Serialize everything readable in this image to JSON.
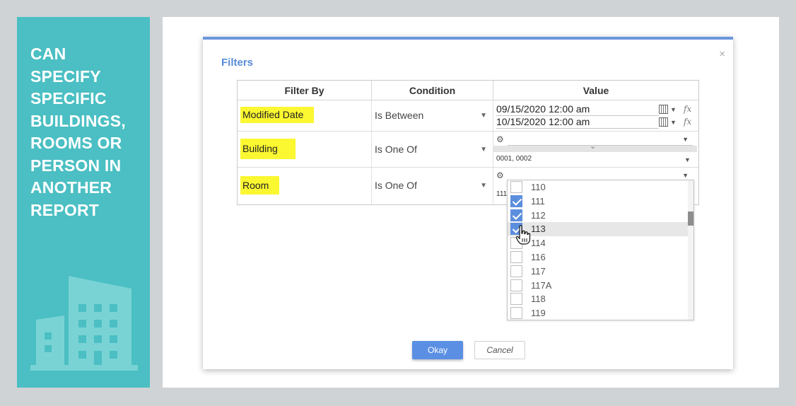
{
  "sidebar": {
    "lines": [
      "CAN",
      "SPECIFY",
      "SPECIFIC",
      "BUILDINGS,",
      "ROOMS OR",
      "PERSON IN",
      "ANOTHER",
      "REPORT"
    ],
    "illustration": "building-icon",
    "bg_color": "#4bbfc3"
  },
  "dialog": {
    "title": "Filters",
    "close_icon": "×",
    "columns": [
      "Filter By",
      "Condition",
      "Value"
    ],
    "rows": [
      {
        "filter_by": "Modified Date",
        "condition": "Is Between",
        "values": [
          "09/15/2020 12:00 am",
          "10/15/2020 12:00 am"
        ]
      },
      {
        "filter_by": "Building",
        "condition": "Is One Of",
        "value_summary": "0001, 0002"
      },
      {
        "filter_by": "Room",
        "condition": "Is One Of",
        "value_summary_partial": "111"
      }
    ],
    "fx_label": "fx",
    "dropdown_arrow": "▼",
    "gear_icon": "⚙",
    "chevron": "⌄",
    "room_options": [
      {
        "label": "110",
        "checked": false
      },
      {
        "label": "111",
        "checked": true
      },
      {
        "label": "112",
        "checked": true
      },
      {
        "label": "113",
        "checked": true,
        "hovered": true
      },
      {
        "label": "114",
        "checked": false
      },
      {
        "label": "116",
        "checked": false
      },
      {
        "label": "117",
        "checked": false
      },
      {
        "label": "117A",
        "checked": false
      },
      {
        "label": "118",
        "checked": false
      },
      {
        "label": "119",
        "checked": false
      }
    ],
    "ok_label": "Okay",
    "cancel_label": "Cancel"
  },
  "colors": {
    "accent": "#5b8fe4",
    "highlight": "#fbf731",
    "title": "#5a8bd6"
  }
}
